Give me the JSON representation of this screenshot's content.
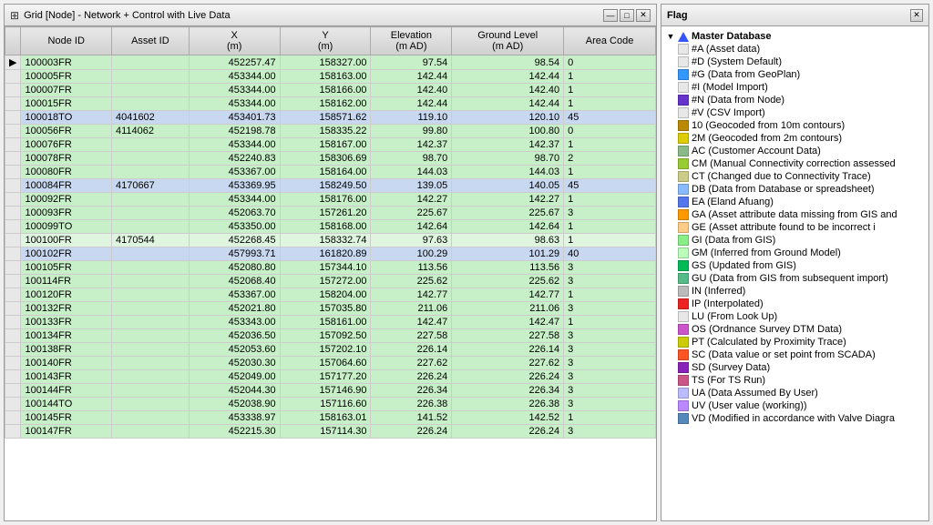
{
  "grid": {
    "title": "Grid [Node] - Network + Control with Live Data",
    "title_icon": "⊞",
    "columns": [
      {
        "id": "node_id",
        "label": "Node ID"
      },
      {
        "id": "asset_id",
        "label": "Asset ID"
      },
      {
        "id": "x",
        "label": "X\n(m)"
      },
      {
        "id": "y",
        "label": "Y\n(m)"
      },
      {
        "id": "elevation",
        "label": "Elevation\n(m AD)"
      },
      {
        "id": "ground_level",
        "label": "Ground Level\n(m AD)"
      },
      {
        "id": "area_code",
        "label": "Area Code"
      }
    ],
    "rows": [
      {
        "node_id": "100003FR",
        "asset_id": "",
        "x": "452257.47",
        "y": "158327.00",
        "elevation": "97.54",
        "ground_level": "98.54",
        "area_code": "0",
        "style": "green"
      },
      {
        "node_id": "100005FR",
        "asset_id": "",
        "x": "453344.00",
        "y": "158163.00",
        "elevation": "142.44",
        "ground_level": "142.44",
        "area_code": "1",
        "style": "green"
      },
      {
        "node_id": "100007FR",
        "asset_id": "",
        "x": "453344.00",
        "y": "158166.00",
        "elevation": "142.40",
        "ground_level": "142.40",
        "area_code": "1",
        "style": "green"
      },
      {
        "node_id": "100015FR",
        "asset_id": "",
        "x": "453344.00",
        "y": "158162.00",
        "elevation": "142.44",
        "ground_level": "142.44",
        "area_code": "1",
        "style": "green"
      },
      {
        "node_id": "100018TO",
        "asset_id": "4041602",
        "x": "453401.73",
        "y": "158571.62",
        "elevation": "119.10",
        "ground_level": "120.10",
        "area_code": "45",
        "style": "blue"
      },
      {
        "node_id": "100056FR",
        "asset_id": "4114062",
        "x": "452198.78",
        "y": "158335.22",
        "elevation": "99.80",
        "ground_level": "100.80",
        "area_code": "0",
        "style": "green"
      },
      {
        "node_id": "100076FR",
        "asset_id": "",
        "x": "453344.00",
        "y": "158167.00",
        "elevation": "142.37",
        "ground_level": "142.37",
        "area_code": "1",
        "style": "green"
      },
      {
        "node_id": "100078FR",
        "asset_id": "",
        "x": "452240.83",
        "y": "158306.69",
        "elevation": "98.70",
        "ground_level": "98.70",
        "area_code": "2",
        "style": "green"
      },
      {
        "node_id": "100080FR",
        "asset_id": "",
        "x": "453367.00",
        "y": "158164.00",
        "elevation": "144.03",
        "ground_level": "144.03",
        "area_code": "1",
        "style": "green"
      },
      {
        "node_id": "100084FR",
        "asset_id": "4170667",
        "x": "453369.95",
        "y": "158249.50",
        "elevation": "139.05",
        "ground_level": "140.05",
        "area_code": "45",
        "style": "blue"
      },
      {
        "node_id": "100092FR",
        "asset_id": "",
        "x": "453344.00",
        "y": "158176.00",
        "elevation": "142.27",
        "ground_level": "142.27",
        "area_code": "1",
        "style": "green"
      },
      {
        "node_id": "100093FR",
        "asset_id": "",
        "x": "452063.70",
        "y": "157261.20",
        "elevation": "225.67",
        "ground_level": "225.67",
        "area_code": "3",
        "style": "green"
      },
      {
        "node_id": "100099TO",
        "asset_id": "",
        "x": "453350.00",
        "y": "158168.00",
        "elevation": "142.64",
        "ground_level": "142.64",
        "area_code": "1",
        "style": "green"
      },
      {
        "node_id": "100100FR",
        "asset_id": "4170544",
        "x": "452268.45",
        "y": "158332.74",
        "elevation": "97.63",
        "ground_level": "98.63",
        "area_code": "1",
        "style": "light-green"
      },
      {
        "node_id": "100102FR",
        "asset_id": "",
        "x": "457993.71",
        "y": "161820.89",
        "elevation": "100.29",
        "ground_level": "101.29",
        "area_code": "40",
        "style": "blue"
      },
      {
        "node_id": "100105FR",
        "asset_id": "",
        "x": "452080.80",
        "y": "157344.10",
        "elevation": "113.56",
        "ground_level": "113.56",
        "area_code": "3",
        "style": "green"
      },
      {
        "node_id": "100114FR",
        "asset_id": "",
        "x": "452068.40",
        "y": "157272.00",
        "elevation": "225.62",
        "ground_level": "225.62",
        "area_code": "3",
        "style": "green"
      },
      {
        "node_id": "100120FR",
        "asset_id": "",
        "x": "453367.00",
        "y": "158204.00",
        "elevation": "142.77",
        "ground_level": "142.77",
        "area_code": "1",
        "style": "green"
      },
      {
        "node_id": "100132FR",
        "asset_id": "",
        "x": "452021.80",
        "y": "157035.80",
        "elevation": "211.06",
        "ground_level": "211.06",
        "area_code": "3",
        "style": "green"
      },
      {
        "node_id": "100133FR",
        "asset_id": "",
        "x": "453343.00",
        "y": "158161.00",
        "elevation": "142.47",
        "ground_level": "142.47",
        "area_code": "1",
        "style": "green"
      },
      {
        "node_id": "100134FR",
        "asset_id": "",
        "x": "452036.50",
        "y": "157092.50",
        "elevation": "227.58",
        "ground_level": "227.58",
        "area_code": "3",
        "style": "green"
      },
      {
        "node_id": "100138FR",
        "asset_id": "",
        "x": "452053.60",
        "y": "157202.10",
        "elevation": "226.14",
        "ground_level": "226.14",
        "area_code": "3",
        "style": "green"
      },
      {
        "node_id": "100140FR",
        "asset_id": "",
        "x": "452030.30",
        "y": "157064.60",
        "elevation": "227.62",
        "ground_level": "227.62",
        "area_code": "3",
        "style": "green"
      },
      {
        "node_id": "100143FR",
        "asset_id": "",
        "x": "452049.00",
        "y": "157177.20",
        "elevation": "226.24",
        "ground_level": "226.24",
        "area_code": "3",
        "style": "green"
      },
      {
        "node_id": "100144FR",
        "asset_id": "",
        "x": "452044.30",
        "y": "157146.90",
        "elevation": "226.34",
        "ground_level": "226.34",
        "area_code": "3",
        "style": "green"
      },
      {
        "node_id": "100144TO",
        "asset_id": "",
        "x": "452038.90",
        "y": "157116.60",
        "elevation": "226.38",
        "ground_level": "226.38",
        "area_code": "3",
        "style": "green"
      },
      {
        "node_id": "100145FR",
        "asset_id": "",
        "x": "453338.97",
        "y": "158163.01",
        "elevation": "141.52",
        "ground_level": "142.52",
        "area_code": "1",
        "style": "green"
      },
      {
        "node_id": "100147FR",
        "asset_id": "",
        "x": "452215.30",
        "y": "157114.30",
        "elevation": "226.24",
        "ground_level": "226.24",
        "area_code": "3",
        "style": "green"
      }
    ]
  },
  "flag_panel": {
    "title": "Flag",
    "close_btn": "✕",
    "tree": {
      "root_label": "Master Database",
      "items": [
        {
          "id": "A",
          "label": "#A (Asset data)",
          "color": "#e8e8e8",
          "type": "hash"
        },
        {
          "id": "D",
          "label": "#D (System Default)",
          "color": "#e8e8e8",
          "type": "hash"
        },
        {
          "id": "G",
          "label": "#G (Data from GeoPlan)",
          "color": "#3399ff",
          "type": "hash"
        },
        {
          "id": "I",
          "label": "#I (Model Import)",
          "color": "#e8e8e8",
          "type": "hash"
        },
        {
          "id": "N",
          "label": "#N (Data from Node)",
          "color": "#6633cc",
          "type": "hash"
        },
        {
          "id": "V",
          "label": "#V (CSV Import)",
          "color": "#e8e8e8",
          "type": "hash"
        },
        {
          "id": "10",
          "label": "10 (Geocoded from 10m contours)",
          "color": "#cc9900",
          "type": "box"
        },
        {
          "id": "2M",
          "label": "2M (Geocoded from 2m contours)",
          "color": "#ffcc00",
          "type": "box"
        },
        {
          "id": "AC",
          "label": "AC (Customer Account Data)",
          "color": "#99cc99",
          "type": "box"
        },
        {
          "id": "CM",
          "label": "CM (Manual Connectivity correction assessed",
          "color": "#99cc00",
          "type": "box"
        },
        {
          "id": "CT",
          "label": "CT (Changed due to Connectivity Trace)",
          "color": "#cccc99",
          "type": "box"
        },
        {
          "id": "DB",
          "label": "DB (Data from Database or spreadsheet)",
          "color": "#99ccff",
          "type": "box"
        },
        {
          "id": "EA",
          "label": "EA (Eland Afuang)",
          "color": "#6699ff",
          "type": "box"
        },
        {
          "id": "GA",
          "label": "GA (Asset attribute data missing from GIS and",
          "color": "#ff9900",
          "type": "box"
        },
        {
          "id": "GE",
          "label": "GE (Asset attribute found to be incorrect i",
          "color": "#ffcc99",
          "type": "box"
        },
        {
          "id": "GI",
          "label": "GI (Data from GIS)",
          "color": "#99ff99",
          "type": "box"
        },
        {
          "id": "GM",
          "label": "GM (Inferred from Ground Model)",
          "color": "#ccffcc",
          "type": "box"
        },
        {
          "id": "GS",
          "label": "GS (Updated from GIS)",
          "color": "#00cc66",
          "type": "box"
        },
        {
          "id": "GU",
          "label": "GU (Data from GIS from subsequent import)",
          "color": "#66cc99",
          "type": "box"
        },
        {
          "id": "IN",
          "label": "IN (Inferred)",
          "color": "#cccccc",
          "type": "box"
        },
        {
          "id": "IP",
          "label": "IP (Interpolated)",
          "color": "#ff3333",
          "type": "box"
        },
        {
          "id": "LU",
          "label": "LU (From Look Up)",
          "color": "#e8e8e8",
          "type": "box"
        },
        {
          "id": "OS",
          "label": "OS (Ordnance Survey DTM Data)",
          "color": "#cc66cc",
          "type": "box"
        },
        {
          "id": "PT",
          "label": "PT (Calculated by Proximity Trace)",
          "color": "#cccc00",
          "type": "box"
        },
        {
          "id": "SC",
          "label": "SC (Data value or set point from SCADA)",
          "color": "#ff6633",
          "type": "box"
        },
        {
          "id": "SD",
          "label": "SD (Survey Data)",
          "color": "#9933cc",
          "type": "box"
        },
        {
          "id": "TS",
          "label": "TS (For TS Run)",
          "color": "#cc6699",
          "type": "box"
        },
        {
          "id": "UA",
          "label": "UA (Data Assumed By User)",
          "color": "#ccccff",
          "type": "box"
        },
        {
          "id": "UV",
          "label": "UV (User value (working))",
          "color": "#cc99ff",
          "type": "box"
        },
        {
          "id": "VD",
          "label": "VD (Modified in accordance with Valve Diagra",
          "color": "#6699cc",
          "type": "box"
        }
      ]
    }
  },
  "window_controls": {
    "minimize": "—",
    "maximize": "□",
    "close": "✕"
  }
}
